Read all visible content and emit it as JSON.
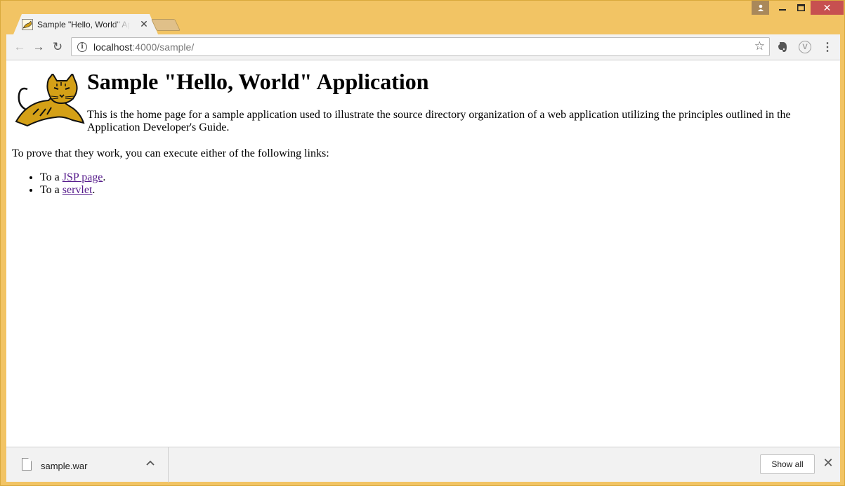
{
  "window": {
    "controls": {
      "user": "👤",
      "minimize": "–",
      "maximize": "□",
      "close": "✕"
    }
  },
  "tab": {
    "title": "Sample \"Hello, World\" Application",
    "close": "✕"
  },
  "toolbar": {
    "back": "←",
    "forward": "→",
    "reload": "↻",
    "url_host": "localhost",
    "url_path": ":4000/sample/",
    "star": "☆",
    "menu": "⋮",
    "extension_v": "V"
  },
  "page": {
    "heading": "Sample \"Hello, World\" Application",
    "intro": "This is the home page for a sample application used to illustrate the source directory organization of a web application utilizing the principles outlined in the Application Developer's Guide.",
    "prove": "To prove that they work, you can execute either of the following links:",
    "links": [
      {
        "prefix": "To a ",
        "link": "JSP page",
        "suffix": "."
      },
      {
        "prefix": "To a ",
        "link": "servlet",
        "suffix": "."
      }
    ]
  },
  "downloads": {
    "file_name": "sample.war",
    "chevron": "^",
    "show_all": "Show all",
    "close": "✕"
  },
  "colors": {
    "frame": "#F2C464",
    "link_visited": "#551A8B",
    "close_button": "#C75050"
  }
}
